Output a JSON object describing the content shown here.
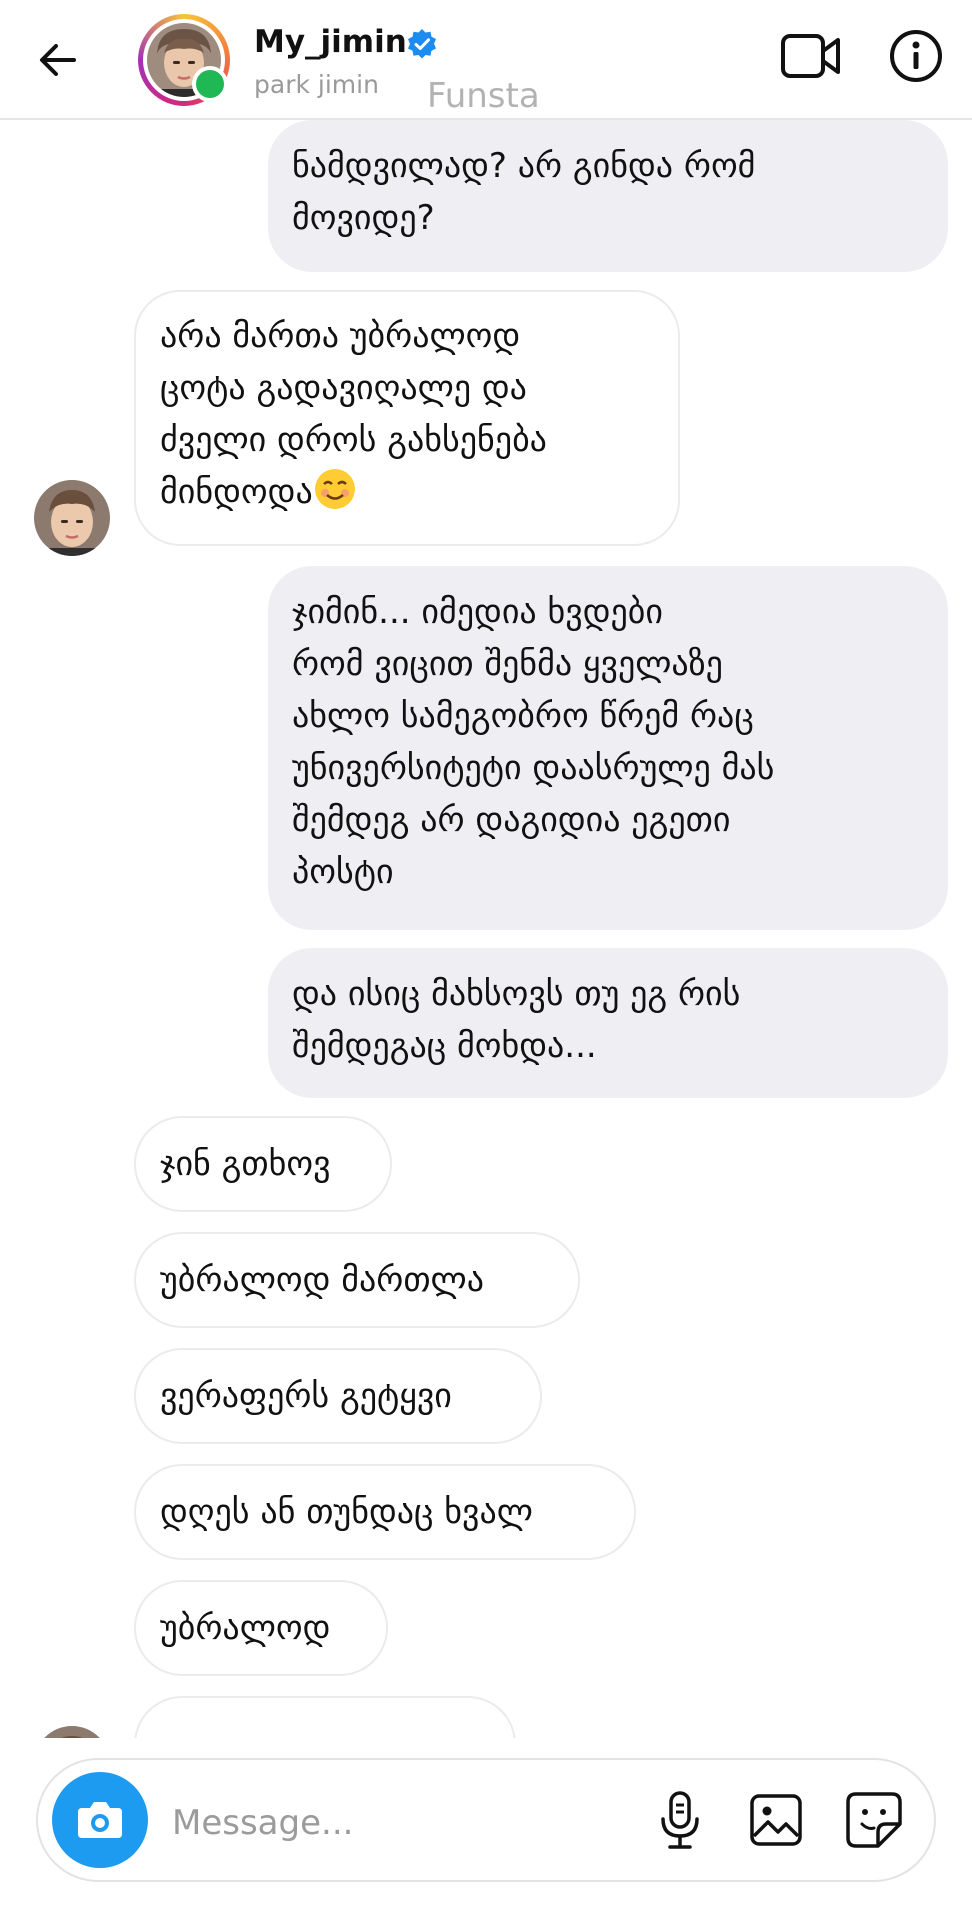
{
  "header": {
    "username": "My_jimin",
    "display_name": "park jimin",
    "overlay_tag": "Funsta",
    "verified": true,
    "online": true,
    "icons": [
      "back-arrow-icon",
      "verified-badge-icon",
      "video-call-icon",
      "info-icon"
    ]
  },
  "messages": [
    {
      "side": "sent",
      "text": "ნამდვილად? არ გინდა რომ\nმოვიდე?"
    },
    {
      "side": "received",
      "text": "არა მართა უბრალოდ\nცოტა გადავიღალე და\nძველი დროს გახსენება\nმინდოდა",
      "emoji": "smiling-face-emoji"
    },
    {
      "side": "sent",
      "text": "ჯიმინ... იმედია ხვდები\nრომ ვიცით შენმა ყველაზე\nახლო სამეგობრო წრემ რაც\nუნივერსიტეტი დაასრულე მას\nშემდეგ არ დაგიდია ეგეთი\nპოსტი"
    },
    {
      "side": "sent",
      "text": "და ისიც მახსოვს თუ ეგ რის\nშემდეგაც მოხდა..."
    },
    {
      "side": "received",
      "text": "ჯინ გთხოვ"
    },
    {
      "side": "received",
      "text": "უბრალოდ მართლა"
    },
    {
      "side": "received",
      "text": "ვერაფერს გეტყვი"
    },
    {
      "side": "received",
      "text": "დღეს ან თუნდაც ხვალ"
    },
    {
      "side": "received",
      "text": "უბრალოდ"
    }
  ],
  "composer": {
    "placeholder": "Message...",
    "icons": [
      "camera-icon",
      "microphone-icon",
      "gallery-icon",
      "sticker-icon"
    ]
  },
  "colors": {
    "accent_blue": "#1d9bf0",
    "online_green": "#1fb855",
    "sent_bubble": "#efeef3",
    "received_border": "#ebebeb"
  }
}
